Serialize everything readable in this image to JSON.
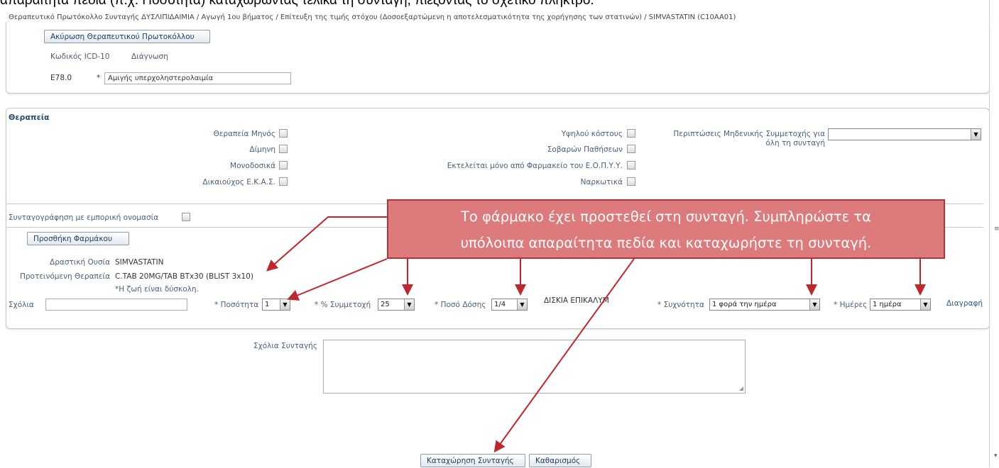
{
  "caption": "απαραίτητα πεδία (π.χ. Ποσότητα) καταχωρώντας τελικά τη συνταγή, πιέζοντας το σχετικό πλήκτρο.",
  "breadcrumb": "Θεραπευτικό Πρωτόκολλο Συνταγής  ΔΥΣΛΙΠΙΔΑΙΜΙΑ / Αγωγή 1ου βήματος / Επίτευξη της τιμής στόχου (Δοσοεξαρτώμενη η αποτελεσματικότητα της χορήγησης των στατινών) / SIMVASTATIN (C10AA01)",
  "protocol": {
    "cancel_button": "Ακύρωση Θεραπευτικού Πρωτοκόλλου",
    "icd_header": "Κωδικός ICD-10",
    "diagnosis_header": "Διάγνωση",
    "icd_code": "E78.0",
    "required_mark": "*",
    "diagnosis_value": "Αμιγής υπερχοληστερολαιμία"
  },
  "therapy": {
    "title": "Θεραπεία",
    "col1": [
      "Θεραπεία Μηνός",
      "Δίμηνη",
      "Μονοδοσικά",
      "Δικαιούχος Ε.Κ.Α.Σ."
    ],
    "col2": [
      "Υψηλού κόστους",
      "Σοβαρών Παθήσεων",
      "Εκτελείται μόνο από Φαρμακείο του Ε.Ο.Π.Υ.Υ.",
      "Ναρκωτικά"
    ],
    "zero_participation_label_1": "Περιπτώσεις Μηδενικής Συμμετοχής για",
    "zero_participation_label_2": "όλη τη συνταγή",
    "zero_participation_value": "",
    "trade_name_label": "Συνταγογράφηση με εμπορική ονομασία",
    "add_drug_button": "Προσθήκη Φαρμάκου",
    "active_substance_label": "Δραστική Ουσία",
    "active_substance_value": "SIMVASTATIN",
    "suggested_label": "Προτεινόμενη Θεραπεία",
    "suggested_value": "C.TAB 20MG/TAB BTx30 (BLIST 3x10)",
    "note": "*Η ζωή είναι δύσκολη.",
    "comments_label": "Σχόλια",
    "quantity_label": "* Ποσότητα",
    "quantity_value": "1",
    "participation_label": "* % Συμμετοχή",
    "participation_value": "25",
    "dose_label": "* Ποσό Δόσης",
    "dose_value": "1/4",
    "form_text": "ΔΙΣΚΙΑ ΕΠΙΚΑΛΥΜ",
    "frequency_label": "* Συχνότητα",
    "frequency_value": "1 φορά την ημέρα",
    "days_label": "* Ημέρες",
    "days_value": "1 ημέρα",
    "delete_link": "Διαγραφή"
  },
  "prescription": {
    "comments_label": "Σχόλια Συνταγής",
    "submit_button": "Καταχώρηση Συνταγής",
    "clear_button": "Καθαρισμός"
  },
  "callout": {
    "line1": "Το φάρμακο έχει προστεθεί στη συνταγή. Συμπληρώστε τα",
    "line2": "υπόλοιπα απαραίτητα πεδία και καταχωρήστε τη συνταγή."
  },
  "colors": {
    "callout_fill": "#dd7a7c",
    "callout_border": "#b03436",
    "arrow": "#c0272d"
  }
}
